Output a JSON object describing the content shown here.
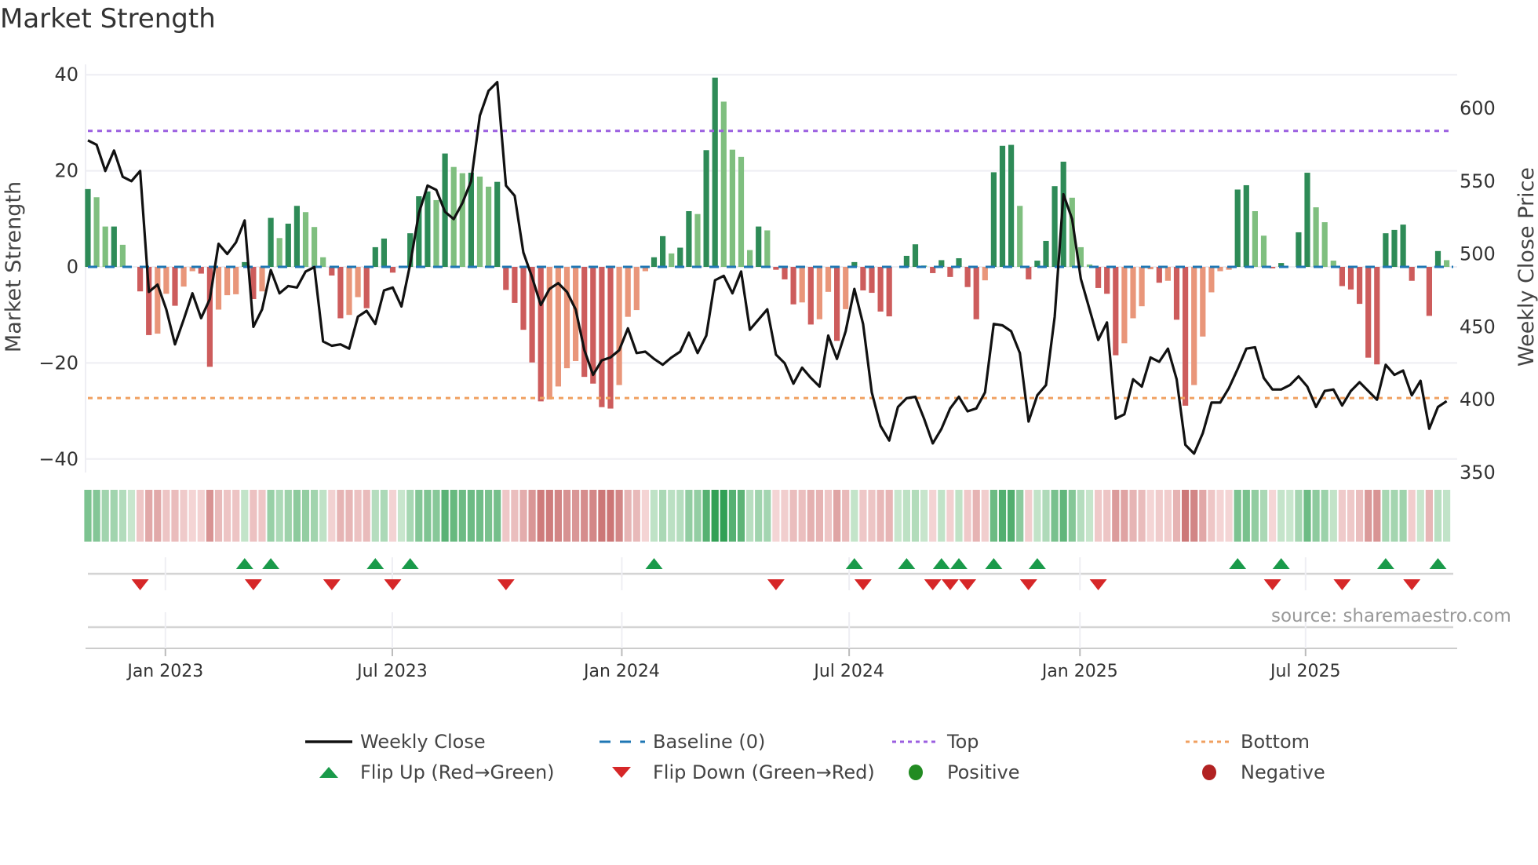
{
  "chart_data": {
    "type": "bar",
    "title": "Market Strength",
    "ylabel": "Market Strength",
    "y2label": "Weekly Close Price",
    "ylim": [
      -42,
      42
    ],
    "y2lim": [
      350,
      625
    ],
    "yticks": [
      -40,
      -20,
      0,
      20,
      40
    ],
    "y2ticks": [
      350,
      400,
      450,
      500,
      550,
      600
    ],
    "ytick_labels": [
      "−40",
      "−20",
      "0",
      "20",
      "40"
    ],
    "y2tick_labels": [
      "350",
      "400",
      "450",
      "500",
      "550",
      "600"
    ],
    "x_unit": "week index",
    "xticks": [
      {
        "label": "Jan 2023",
        "week": 8.9
      },
      {
        "label": "Jul 2023",
        "week": 34.95
      },
      {
        "label": "Jan 2024",
        "week": 61.3
      },
      {
        "label": "Jul 2024",
        "week": 87.4
      },
      {
        "label": "Jan 2025",
        "week": 113.9
      },
      {
        "label": "Jul 2025",
        "week": 139.8
      }
    ],
    "top_level": 28.3,
    "bottom_level": -27.3,
    "baseline": 0,
    "strength": [
      16.2,
      14.5,
      8.4,
      8.4,
      4.6,
      0,
      -5.1,
      -14.2,
      -13.9,
      -5.6,
      -8.1,
      -4.1,
      -0.9,
      -1.4,
      -20.8,
      -8.9,
      -5.9,
      -5.7,
      1.0,
      -6.7,
      -5.1,
      10.2,
      6.0,
      9.0,
      12.7,
      11.4,
      8.3,
      2.0,
      -1.8,
      -10.7,
      -10.0,
      -6.3,
      -8.6,
      4.1,
      5.9,
      -1.2,
      0,
      7.0,
      14.7,
      15.7,
      13.9,
      23.6,
      20.8,
      19.5,
      19.6,
      18.8,
      16.7,
      17.7,
      -4.8,
      -7.5,
      -13.1,
      -19.9,
      -28.0,
      -27.6,
      -24.9,
      -21.1,
      -19.6,
      -22.9,
      -24.3,
      -29.2,
      -29.5,
      -24.6,
      -10.4,
      -9.0,
      -0.9,
      2.0,
      6.4,
      2.8,
      4.0,
      11.6,
      11.0,
      24.3,
      39.4,
      34.4,
      24.4,
      22.9,
      3.5,
      8.4,
      7.6,
      -0.6,
      -2.6,
      -7.8,
      -7.4,
      -12.0,
      -10.9,
      -5.2,
      -15.4,
      -8.8,
      1.0,
      -4.9,
      -5.4,
      -9.3,
      -10.3,
      0,
      2.3,
      4.7,
      0.3,
      -1.3,
      1.4,
      -2.1,
      1.8,
      -4.2,
      -10.9,
      -2.8,
      19.7,
      25.2,
      25.4,
      12.7,
      -2.6,
      1.3,
      5.4,
      16.8,
      21.9,
      14.4,
      4.1,
      0.5,
      -4.4,
      -5.6,
      -18.4,
      -15.9,
      -10.7,
      -8.2,
      -0.5,
      -3.3,
      -2.9,
      -11.0,
      -28.9,
      -24.6,
      -14.5,
      -5.3,
      -0.9,
      -0.6,
      16.1,
      17.0,
      11.6,
      6.5,
      -0.3,
      0.8,
      0,
      7.2,
      19.6,
      12.4,
      9.3,
      1.3,
      -4.0,
      -4.7,
      -7.7,
      -18.9,
      -20.3,
      7.0,
      7.7,
      8.8,
      -2.9,
      0,
      -10.2,
      3.3,
      1.4
    ],
    "weekly_close": [
      578,
      575,
      557,
      571,
      553,
      550,
      557,
      474,
      479,
      462,
      438,
      455,
      473,
      456,
      469,
      507,
      500,
      508,
      523,
      450,
      462,
      489,
      473,
      478,
      477,
      488,
      491,
      440,
      437,
      438,
      435,
      457,
      461,
      452,
      475,
      477,
      464,
      493,
      528,
      547,
      544,
      529,
      524,
      535,
      550,
      595,
      612,
      618,
      547,
      540,
      501,
      484,
      465,
      476,
      480,
      474,
      462,
      434,
      417,
      427,
      429,
      434,
      449,
      432,
      433,
      428,
      424,
      429,
      433,
      446,
      432,
      444,
      482,
      485,
      473,
      488,
      448,
      455,
      462,
      431,
      425,
      411,
      422,
      415,
      409,
      444,
      428,
      447,
      476,
      452,
      405,
      382,
      372,
      395,
      401,
      402,
      387,
      370,
      380,
      394,
      402,
      392,
      394,
      405,
      452,
      451,
      447,
      432,
      385,
      403,
      410,
      457,
      541,
      524,
      483,
      462,
      441,
      453,
      387,
      390,
      414,
      409,
      429,
      426,
      435,
      414,
      369,
      363,
      377,
      398,
      398,
      408,
      421,
      435,
      436,
      415,
      407,
      407,
      410,
      416,
      409,
      395,
      406,
      407,
      396,
      406,
      412,
      406,
      400,
      424,
      417,
      420,
      403,
      413,
      380,
      395,
      399
    ],
    "legend": [
      {
        "label": "Weekly Close",
        "kind": "line",
        "color": "#111111"
      },
      {
        "label": "Baseline (0)",
        "kind": "dash",
        "color": "#1f77b4"
      },
      {
        "label": "Top",
        "kind": "dot",
        "color": "#9b5fe0"
      },
      {
        "label": "Bottom",
        "kind": "dot",
        "color": "#f0a060"
      },
      {
        "label": "Flip Up (Red→Green)",
        "kind": "tri-up",
        "color": "#1a9a4a"
      },
      {
        "label": "Flip Down (Green→Red)",
        "kind": "tri-down",
        "color": "#d62728"
      },
      {
        "label": "Positive",
        "kind": "dot-marker",
        "color": "#228b22"
      },
      {
        "label": "Negative",
        "kind": "dot-marker",
        "color": "#b22222"
      }
    ],
    "legend_placement": "bottom",
    "colors": {
      "pos_strong": "#2e8b57",
      "pos_weak": "#7fbf7f",
      "neg_strong": "#cd5c5c",
      "neg_weak": "#e9967a",
      "grid": "#eeeef3"
    }
  },
  "source": "source: sharemaestro.com"
}
